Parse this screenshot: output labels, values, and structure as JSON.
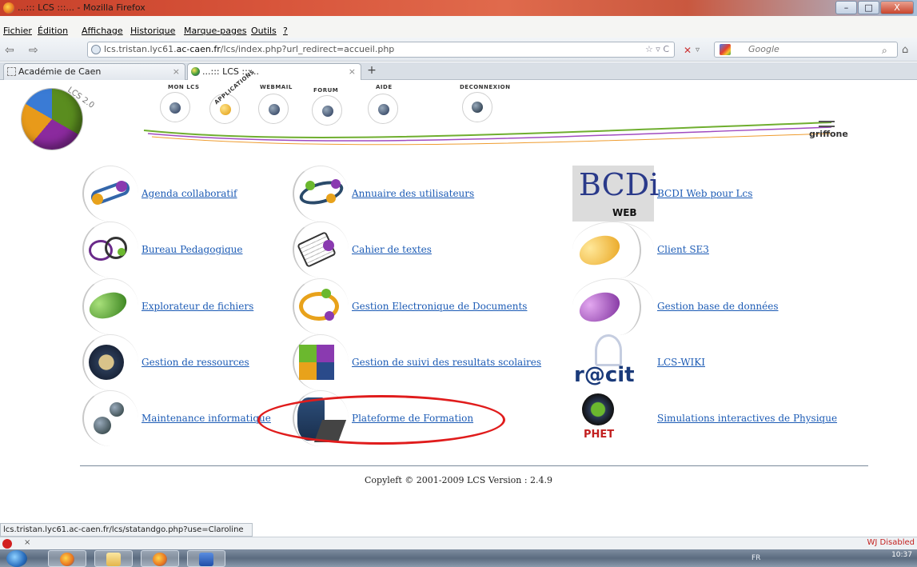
{
  "window": {
    "title": "...::: LCS :::... - Mozilla Firefox",
    "buttons": {
      "minimize": "–",
      "maximize": "□",
      "close": "X"
    }
  },
  "menu": {
    "items": [
      "Fichier",
      "Édition",
      "Affichage",
      "Historique",
      "Marque-pages",
      "Outils",
      "?"
    ]
  },
  "navbar": {
    "url_host_prefix": "lcs.tristan.lyc61.",
    "url_host_bold": "ac-caen.fr",
    "url_path": "/lcs/index.php?url_redirect=accueil.php",
    "search_placeholder": "Google"
  },
  "tabs": [
    {
      "label": "Académie de Caen",
      "close": "×"
    },
    {
      "label": "...::: LCS :::...",
      "close": "×"
    }
  ],
  "new_tab_label": "+",
  "header": {
    "logo_text": "LCS 2.0",
    "nav": [
      {
        "label": "MON LCS"
      },
      {
        "label": "APPLICATIONS"
      },
      {
        "label": "WEBMAIL"
      },
      {
        "label": "FORUM"
      },
      {
        "label": "AIDE"
      },
      {
        "label": "DECONNEXION"
      }
    ],
    "user": "griffone"
  },
  "apps": [
    {
      "label": "Agenda collaboratif",
      "icon": "agenda-icon"
    },
    {
      "label": "Annuaire des utilisateurs",
      "icon": "annuaire-icon"
    },
    {
      "label": "BCDI Web pour Lcs",
      "icon": "bcdi-icon"
    },
    {
      "label": "Bureau Pedagogique",
      "icon": "bureau-icon"
    },
    {
      "label": "Cahier de textes",
      "icon": "cahier-icon"
    },
    {
      "label": "Client SE3",
      "icon": "client-se3-icon"
    },
    {
      "label": "Explorateur de fichiers",
      "icon": "explorateur-icon"
    },
    {
      "label": "Gestion Electronique de Documents",
      "icon": "ged-icon"
    },
    {
      "label": "Gestion base de données",
      "icon": "database-icon"
    },
    {
      "label": "Gestion de ressources",
      "icon": "ressources-icon"
    },
    {
      "label": "Gestion de suivi des resultats scolaires",
      "icon": "puzzle-icon"
    },
    {
      "label": "LCS-WIKI",
      "icon": "recit-icon"
    },
    {
      "label": "Maintenance informatique",
      "icon": "maintenance-icon"
    },
    {
      "label": "Plateforme de Formation",
      "icon": "formation-icon"
    },
    {
      "label": "Simulations interactives de Physique",
      "icon": "phet-icon"
    }
  ],
  "bcdi_text": "BCDi",
  "bcdi_sub": "WEB",
  "recit_text": "r@cit",
  "phet_text": "PHET",
  "copyright": "Copyleft © 2001-2009 LCS Version : 2.4.9",
  "statusbar": "lcs.tristan.lyc61.ac-caen.fr/lcs/statandgo.php?use=Claroline",
  "addonbar": {
    "close": "×",
    "wj": "WJ Disabled"
  },
  "taskbar": {
    "lang": "FR",
    "time": "10:37"
  },
  "colors": {
    "link": "#1c5bb5",
    "highlight": "#e01c1c"
  }
}
